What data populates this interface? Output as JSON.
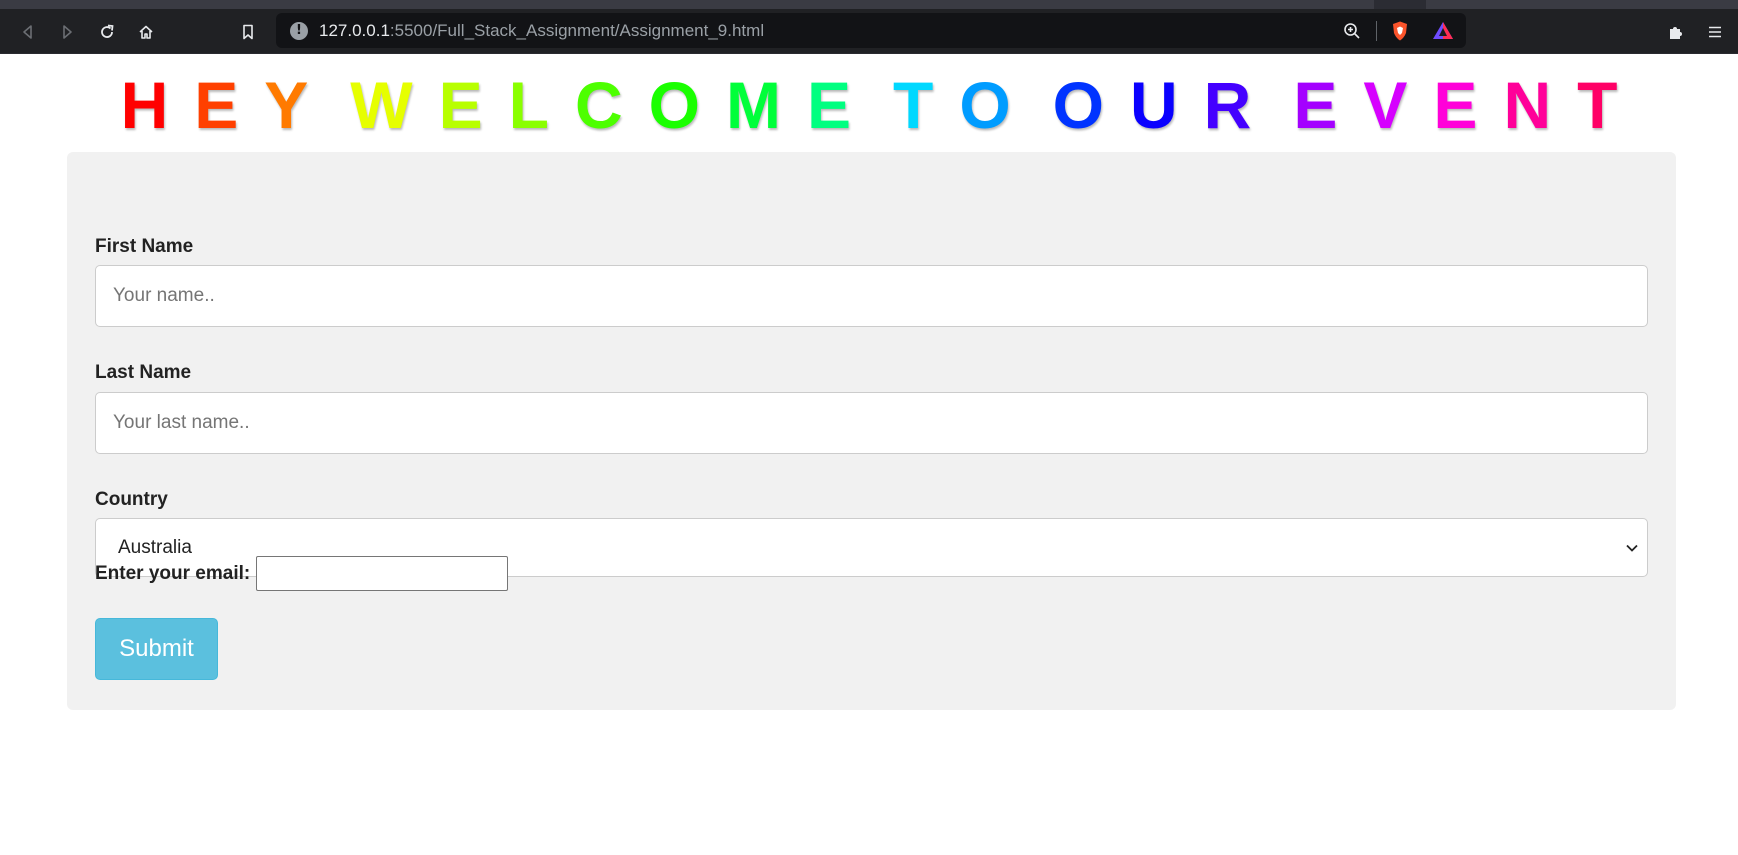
{
  "browser": {
    "url_host": "127.0.0.1",
    "url_rest": ":5500/Full_Stack_Assignment/Assignment_9.html",
    "icons": [
      "back-icon",
      "forward-icon",
      "reload-icon",
      "home-icon",
      "bookmark-icon",
      "site-info-icon",
      "zoom-icon",
      "brave-shields-icon",
      "brave-rewards-icon",
      "extensions-icon",
      "menu-icon"
    ]
  },
  "heading": {
    "words": [
      {
        "letters": [
          {
            "c": "H",
            "color": "#ff0000"
          },
          {
            "c": "E",
            "color": "#ff4000"
          },
          {
            "c": "Y",
            "color": "#ff7a00"
          }
        ]
      },
      {
        "letters": [
          {
            "c": "W",
            "color": "#e6ff00"
          },
          {
            "c": "E",
            "color": "#b8ff00"
          },
          {
            "c": "L",
            "color": "#8aff00"
          },
          {
            "c": "C",
            "color": "#4dff00"
          },
          {
            "c": "O",
            "color": "#1aff00"
          },
          {
            "c": "M",
            "color": "#00ff3a"
          },
          {
            "c": "E",
            "color": "#00ff80"
          }
        ]
      },
      {
        "letters": [
          {
            "c": "T",
            "color": "#00d8ff"
          },
          {
            "c": "O",
            "color": "#009cff"
          }
        ]
      },
      {
        "letters": [
          {
            "c": "O",
            "color": "#0033ff"
          },
          {
            "c": "U",
            "color": "#0a00ff"
          },
          {
            "c": "R",
            "color": "#4400ff"
          }
        ]
      },
      {
        "letters": [
          {
            "c": "E",
            "color": "#a400ff"
          },
          {
            "c": "V",
            "color": "#d600ff"
          },
          {
            "c": "E",
            "color": "#ff00d9"
          },
          {
            "c": "N",
            "color": "#ff0099"
          },
          {
            "c": "T",
            "color": "#ff0066"
          }
        ]
      }
    ]
  },
  "form": {
    "first_name_label": "First Name",
    "first_name_placeholder": "Your name..",
    "last_name_label": "Last Name",
    "last_name_placeholder": "Your last name..",
    "country_label": "Country",
    "country_value": "Australia",
    "email_label": "Enter your email:",
    "email_value": "",
    "submit_label": "Submit"
  },
  "colors": {
    "submit_bg": "#5bc0de",
    "card_bg": "#f1f1f1"
  }
}
